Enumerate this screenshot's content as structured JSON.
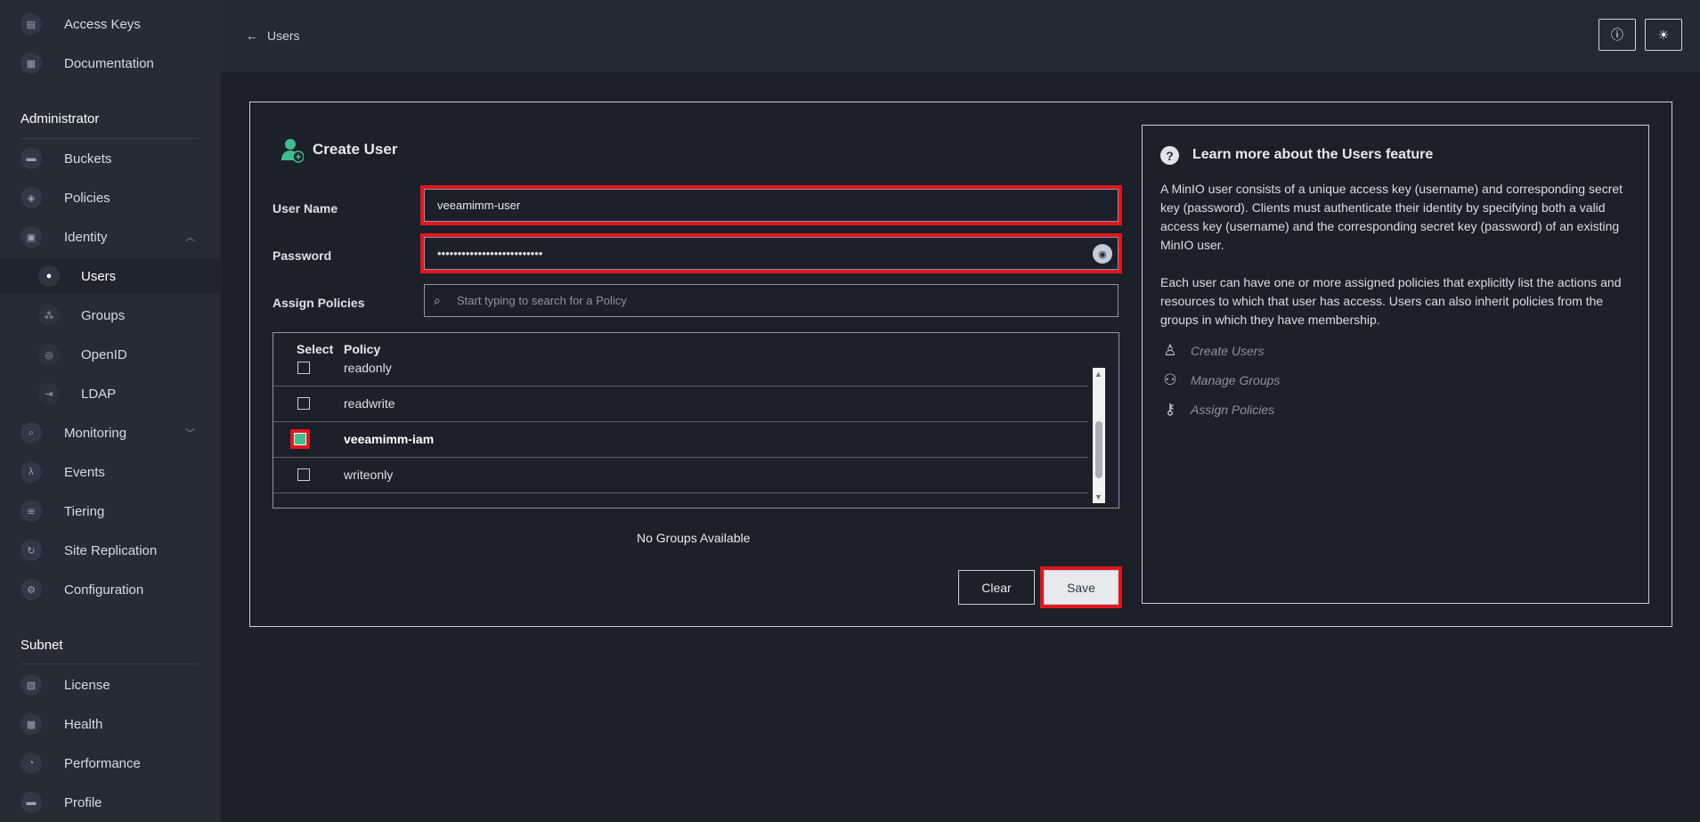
{
  "sidebar": {
    "top_items": [
      {
        "label": "Access Keys",
        "icon": "key-icon"
      },
      {
        "label": "Documentation",
        "icon": "document-icon"
      }
    ],
    "admin_title": "Administrator",
    "admin_items": [
      {
        "label": "Buckets",
        "icon": "bucket-icon"
      },
      {
        "label": "Policies",
        "icon": "shield-icon"
      },
      {
        "label": "Identity",
        "icon": "id-card-icon"
      }
    ],
    "identity_items": [
      {
        "label": "Users",
        "icon": "user-icon"
      },
      {
        "label": "Groups",
        "icon": "group-icon"
      },
      {
        "label": "OpenID",
        "icon": "openid-icon"
      },
      {
        "label": "LDAP",
        "icon": "login-icon"
      }
    ],
    "more_items": [
      {
        "label": "Monitoring",
        "icon": "magnifier-icon"
      },
      {
        "label": "Events",
        "icon": "lambda-icon"
      },
      {
        "label": "Tiering",
        "icon": "layers-icon"
      },
      {
        "label": "Site Replication",
        "icon": "replicate-icon"
      },
      {
        "label": "Configuration",
        "icon": "gear-icon"
      }
    ],
    "subnet_title": "Subnet",
    "subnet_items": [
      {
        "label": "License",
        "icon": "license-icon"
      },
      {
        "label": "Health",
        "icon": "health-icon"
      },
      {
        "label": "Performance",
        "icon": "speedometer-icon"
      },
      {
        "label": "Profile",
        "icon": "profile-icon"
      }
    ]
  },
  "header": {
    "back_label": "Users"
  },
  "form": {
    "title": "Create User",
    "username_label": "User Name",
    "username_value": "veeamimm-user",
    "password_label": "Password",
    "password_value": "••••••••••••••••••••••••••",
    "policies_label": "Assign Policies",
    "policies_placeholder": "Start typing to search for a Policy",
    "table_headers": [
      "Select",
      "Policy"
    ],
    "policies": [
      {
        "name": "readonly",
        "checked": false
      },
      {
        "name": "readwrite",
        "checked": false
      },
      {
        "name": "veeamimm-iam",
        "checked": true
      },
      {
        "name": "writeonly",
        "checked": false
      }
    ],
    "no_groups": "No Groups Available",
    "clear_label": "Clear",
    "save_label": "Save"
  },
  "info": {
    "title": "Learn more about the Users feature",
    "paragraph1": "A MinIO user consists of a unique access key (username) and corresponding secret key (password). Clients must authenticate their identity by specifying both a valid access key (username) and the corresponding secret key (password) of an existing MinIO user.",
    "paragraph2": "Each user can have one or more assigned policies that explicitly list the actions and resources to which that user has access. Users can also inherit policies from the groups in which they have membership.",
    "links": [
      "Create Users",
      "Manage Groups",
      "Assign Policies"
    ]
  },
  "colors": {
    "highlight": "#e4151d",
    "checked": "#3fbd8f",
    "accent_user_icon": "#3fbd8f"
  }
}
